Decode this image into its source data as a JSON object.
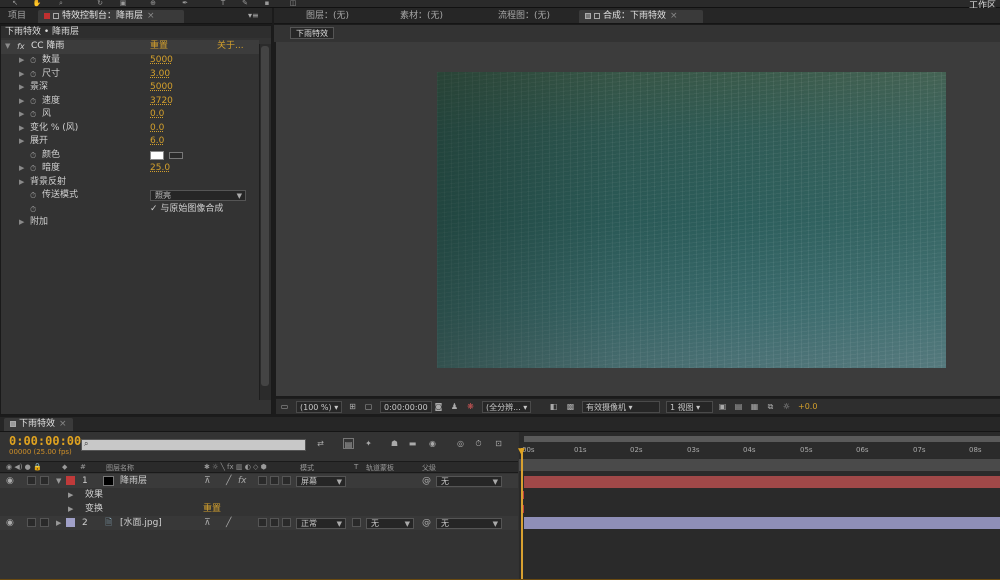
{
  "toolbar": {
    "workspace": "工作区"
  },
  "left_tabs": {
    "project": "项目",
    "effect_controls": "特效控制台：降雨层"
  },
  "effect_controls": {
    "breadcrumb": "下雨特效 • 降雨层",
    "fx_name": "CC 降雨",
    "reset": "重置",
    "about": "关于...",
    "params": [
      {
        "label": "数量",
        "value": "5000",
        "stopwatch": true
      },
      {
        "label": "尺寸",
        "value": "3.00",
        "stopwatch": true
      },
      {
        "label": "景深",
        "value": "5000",
        "stopwatch": false
      },
      {
        "label": "速度",
        "value": "3720",
        "stopwatch": true
      },
      {
        "label": "风",
        "value": "0.0",
        "stopwatch": true
      },
      {
        "label": "变化 % (风)",
        "value": "0.0",
        "stopwatch": false
      },
      {
        "label": "展开",
        "value": "6.0",
        "stopwatch": false
      },
      {
        "label": "颜色",
        "value": "",
        "stopwatch": true
      },
      {
        "label": "暗度",
        "value": "25.0",
        "stopwatch": true
      },
      {
        "label": "背景反射",
        "value": "",
        "stopwatch": false
      },
      {
        "label": "传送模式",
        "value": "",
        "stopwatch": true
      },
      {
        "label": "",
        "value": "",
        "stopwatch": true
      },
      {
        "label": "附加",
        "value": "",
        "stopwatch": false
      }
    ],
    "transfer_mode": "照亮",
    "composite_checkbox": "与原始图像合成",
    "color_hex": "#ffffff"
  },
  "viewer_tabs": {
    "layer": "图层：(无)",
    "footage": "素材：(无)",
    "flowchart": "流程图：(无)",
    "composition": "合成：下雨特效"
  },
  "viewer": {
    "comp_button": "下雨特效",
    "zoom": "(100 %)",
    "timecode": "0:00:00:00",
    "resolution": "(全分辨...",
    "camera": "有效摄像机",
    "views": "1 视图",
    "exposure": "+0.0"
  },
  "timeline": {
    "tab": "下雨特效",
    "timecode": "0:00:00:00",
    "fps": "00000 (25.00 fps)",
    "headers": {
      "source": "图层名称",
      "mode": "模式",
      "t": "T",
      "trkmat": "轨道蒙板",
      "parent": "父级"
    },
    "layers": [
      {
        "num": "1",
        "name": "降雨层",
        "mode": "屏幕",
        "trkmat": "",
        "parent": "无",
        "color": "#c03a3a"
      },
      {
        "num": "2",
        "name": "[水面.jpg]",
        "mode": "正常",
        "trkmat": "无",
        "parent": "无",
        "color": "#a0a0c8"
      }
    ],
    "sub_effects": "效果",
    "sub_transform": "变换",
    "sub_reset": "重置",
    "ruler": [
      "00s",
      "01s",
      "02s",
      "03s",
      "04s",
      "05s",
      "06s",
      "07s",
      "08s"
    ]
  }
}
